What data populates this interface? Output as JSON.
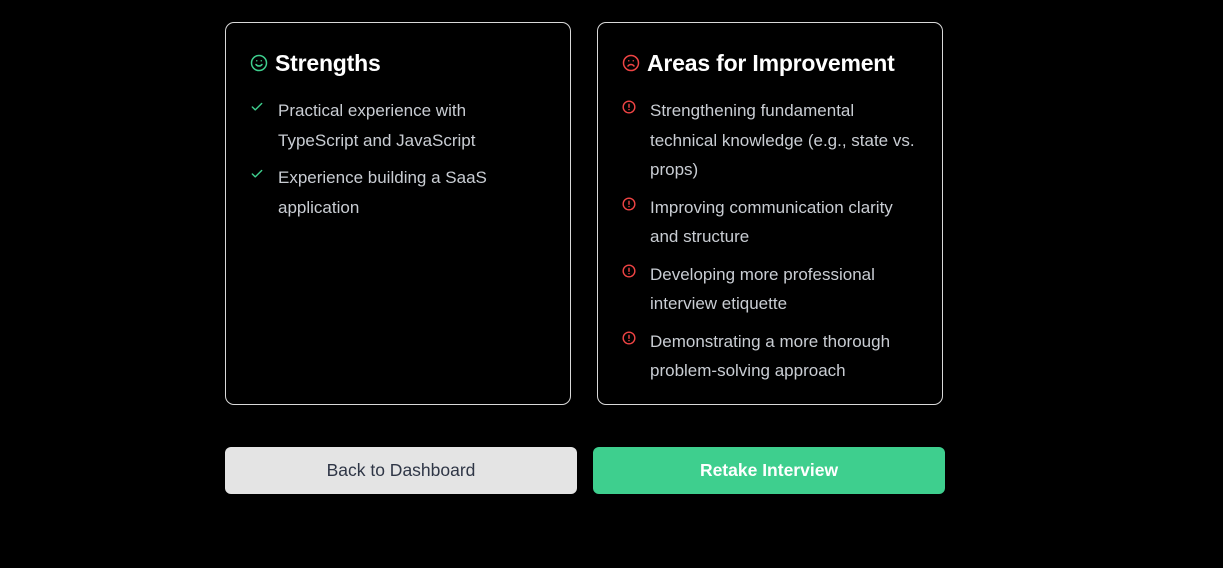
{
  "strengths": {
    "title": "Strengths",
    "icon": "smile-icon",
    "accent": "#3ecf8e",
    "items": [
      "Practical experience with TypeScript and JavaScript",
      "Experience building a SaaS application"
    ]
  },
  "improvement": {
    "title": "Areas for Improvement",
    "icon": "frown-icon",
    "accent": "#ef4444",
    "items": [
      "Strengthening fundamental technical knowledge (e.g., state vs. props)",
      "Improving communication clarity and structure",
      "Developing more professional interview etiquette",
      "Demonstrating a more thorough problem-solving approach"
    ]
  },
  "actions": {
    "back_label": "Back to Dashboard",
    "retake_label": "Retake Interview",
    "retake_color": "#3ecf8e"
  }
}
